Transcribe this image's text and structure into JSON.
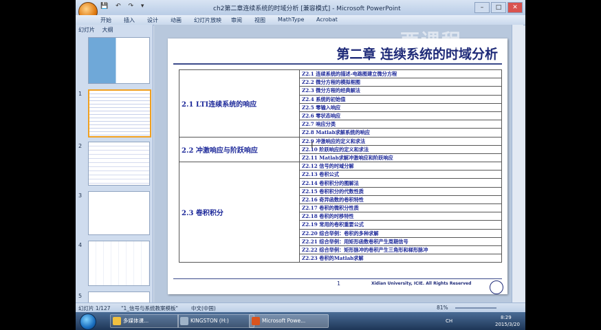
{
  "window": {
    "title": "ch2第二章连续系统的时域分析 [兼容模式] - Microsoft PowerPoint",
    "controls": [
      "–",
      "□",
      "✕"
    ]
  },
  "ribbon_tabs": [
    "开始",
    "插入",
    "设计",
    "动画",
    "幻灯片放映",
    "审阅",
    "视图",
    "MathType",
    "Acrobat"
  ],
  "left_pane": {
    "tabs": [
      "幻灯片",
      "大纲"
    ],
    "thumb_numbers": [
      "1",
      "2",
      "3",
      "4",
      "5"
    ]
  },
  "watermark": "西课程",
  "slide": {
    "title": "第二章 连续系统的时域分析",
    "sections": [
      {
        "name": "2.1 LTI连续系统的响应",
        "items": [
          "Z2.1 连续系统的描述-电路图建立微分方程",
          "Z2.2 微分方程的模拟框图",
          "Z2.3 微分方程的经典解法",
          "Z2.4 系统的初始值",
          "Z2.5 零输入响应",
          "Z2.6 零状态响应",
          "Z2.7 响应分类",
          "Z2.8 Matlab求解系统的响应"
        ]
      },
      {
        "name": "2.2 冲激响应与阶跃响应",
        "items": [
          "Z2.9 冲激响应的定义和求法",
          "Z2.10 阶跃响应的定义和求法",
          "Z2.11 Matlab求解冲激响应和阶跃响应"
        ]
      },
      {
        "name": "2.3 卷积积分",
        "items": [
          "Z2.12 信号的时域分解",
          "Z2.13 卷积公式",
          "Z2.14 卷积积分的图解法",
          "Z2.15 卷积积分的代数性质",
          "Z2.16 奇异函数的卷积特性",
          "Z2.17 卷积的微积分性质",
          "Z2.18 卷积的时移特性",
          "Z2.19 常用的卷积重要公式",
          "Z2.20 综合举例：卷积的多种求解",
          "Z2.21 综合举例：用矩形函数卷积产生周期信号",
          "Z2.22 综合举例：矩形脉冲的卷积产生三角形和梯形脉冲",
          "Z2.23 卷积的Matlab求解"
        ]
      }
    ],
    "page_number": "1",
    "footer": "Xidian University, ICIE. All Rights Reserved"
  },
  "statusbar": {
    "slide_pos": "幻灯片 1/127",
    "theme": "\"1_信号与系统教案模板\"",
    "language": "中文(中国)",
    "zoom": "81%"
  },
  "taskbar": {
    "items": [
      {
        "label": "多媒体课...",
        "color": "#f0c040"
      },
      {
        "label": "KINGSTON (H:)",
        "color": "#9fb3c8"
      },
      {
        "label": "Microsoft Powe...",
        "color": "#d9541e"
      }
    ],
    "lang_indicator": "CH",
    "time": "8:29",
    "date": "2015/3/20"
  }
}
